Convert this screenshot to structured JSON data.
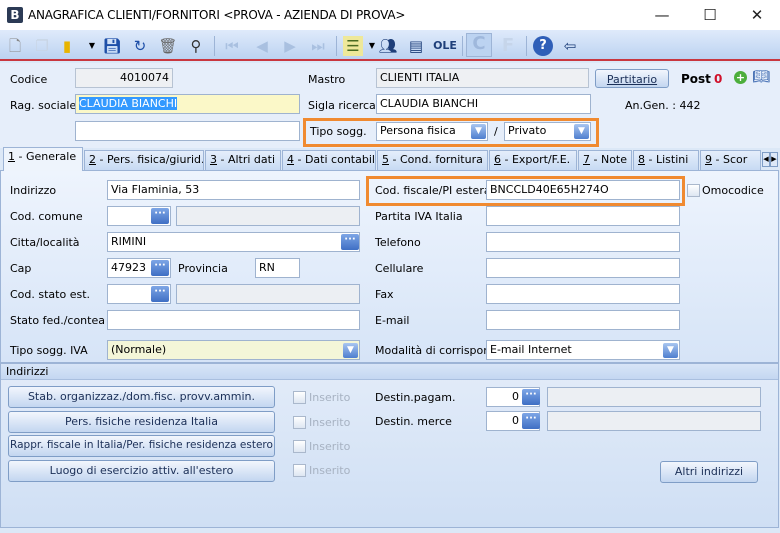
{
  "window": {
    "app_letter": "B",
    "title": "ANAGRAFICA CLIENTI/FORNITORI <PROVA - AZIENDA DI PROVA>",
    "minimize": "—",
    "maximize": "☐",
    "close": "✕"
  },
  "toolbar": {
    "icons": [
      "new-document",
      "copy-document",
      "open-folder",
      "save",
      "undo",
      "delete",
      "binoculars",
      "first",
      "previous",
      "next",
      "last",
      "list",
      "users",
      "contact-card",
      "ole",
      "c-button",
      "f-button",
      "help",
      "exit"
    ]
  },
  "header": {
    "codice_label": "Codice",
    "codice_value": "4010074",
    "mastro_label": "Mastro",
    "mastro_value": "CLIENTI ITALIA",
    "partitario_label": "Partitario",
    "post_label": "Post",
    "post_value": "0",
    "rag_sociale_label": "Rag. sociale",
    "rag_sociale_value": "CLAUDIA BIANCHI",
    "sigla_label": "Sigla ricerca",
    "sigla_value": "CLAUDIA BIANCHI",
    "an_gen": "An.Gen.  : 442",
    "tipo_sogg_label": "Tipo sogg.",
    "tipo_sogg_value": "Persona fisica",
    "slash": "/",
    "tipo_sogg2_value": "Privato"
  },
  "tabs": [
    {
      "num": "1",
      "label": " - Generale"
    },
    {
      "num": "2",
      "label": " - Pers. fisica/giurid."
    },
    {
      "num": "3",
      "label": " - Altri dati"
    },
    {
      "num": "4",
      "label": " - Dati contabili"
    },
    {
      "num": "5",
      "label": " - Cond. fornitura"
    },
    {
      "num": "6",
      "label": " - Export/F.E."
    },
    {
      "num": "7",
      "label": " - Note"
    },
    {
      "num": "8",
      "label": " - Listini"
    },
    {
      "num": "9",
      "label": " - Scor"
    }
  ],
  "general": {
    "indirizzo_label": "Indirizzo",
    "indirizzo_value": "Via Flaminia, 53",
    "cod_comune_label": "Cod. comune",
    "citta_label": "Citta/località",
    "citta_value": "RIMINI",
    "cap_label": "Cap",
    "cap_value": "47923",
    "provincia_label": "Provincia",
    "provincia_value": "RN",
    "cod_stato_label": "Cod. stato est.",
    "stato_fed_label": "Stato fed./contea",
    "tipo_iva_label": "Tipo sogg. IVA",
    "tipo_iva_value": "(Normale)",
    "cod_fiscale_label": "Cod. fiscale/PI estera",
    "cod_fiscale_value": "BNCCLD40E65H274O",
    "omocodice_label": "Omocodice",
    "partita_iva_label": "Partita IVA Italia",
    "telefono_label": "Telefono",
    "cellulare_label": "Cellulare",
    "fax_label": "Fax",
    "email_label": "E-mail",
    "modalita_label": "Modalità di corrispond.",
    "modalita_value": "E-mail Internet"
  },
  "indirizzi": {
    "title": "Indirizzi",
    "buttons": [
      "Stab. organizzaz./dom.fisc. provv.ammin.",
      "Pers. fisiche residenza Italia",
      "Rappr. fiscale in Italia/Per. fisiche residenza estero",
      "Luogo di esercizio attiv. all'estero"
    ],
    "inserito": "Inserito",
    "destin_pagam_label": "Destin.pagam.",
    "destin_pagam_value": "0",
    "destin_merce_label": "Destin. merce",
    "destin_merce_value": "0",
    "altri_label": "Altri indirizzi"
  },
  "colors": {
    "highlight": "#f08a30",
    "accent_red": "#d0102a",
    "selection": "#3399ff"
  }
}
